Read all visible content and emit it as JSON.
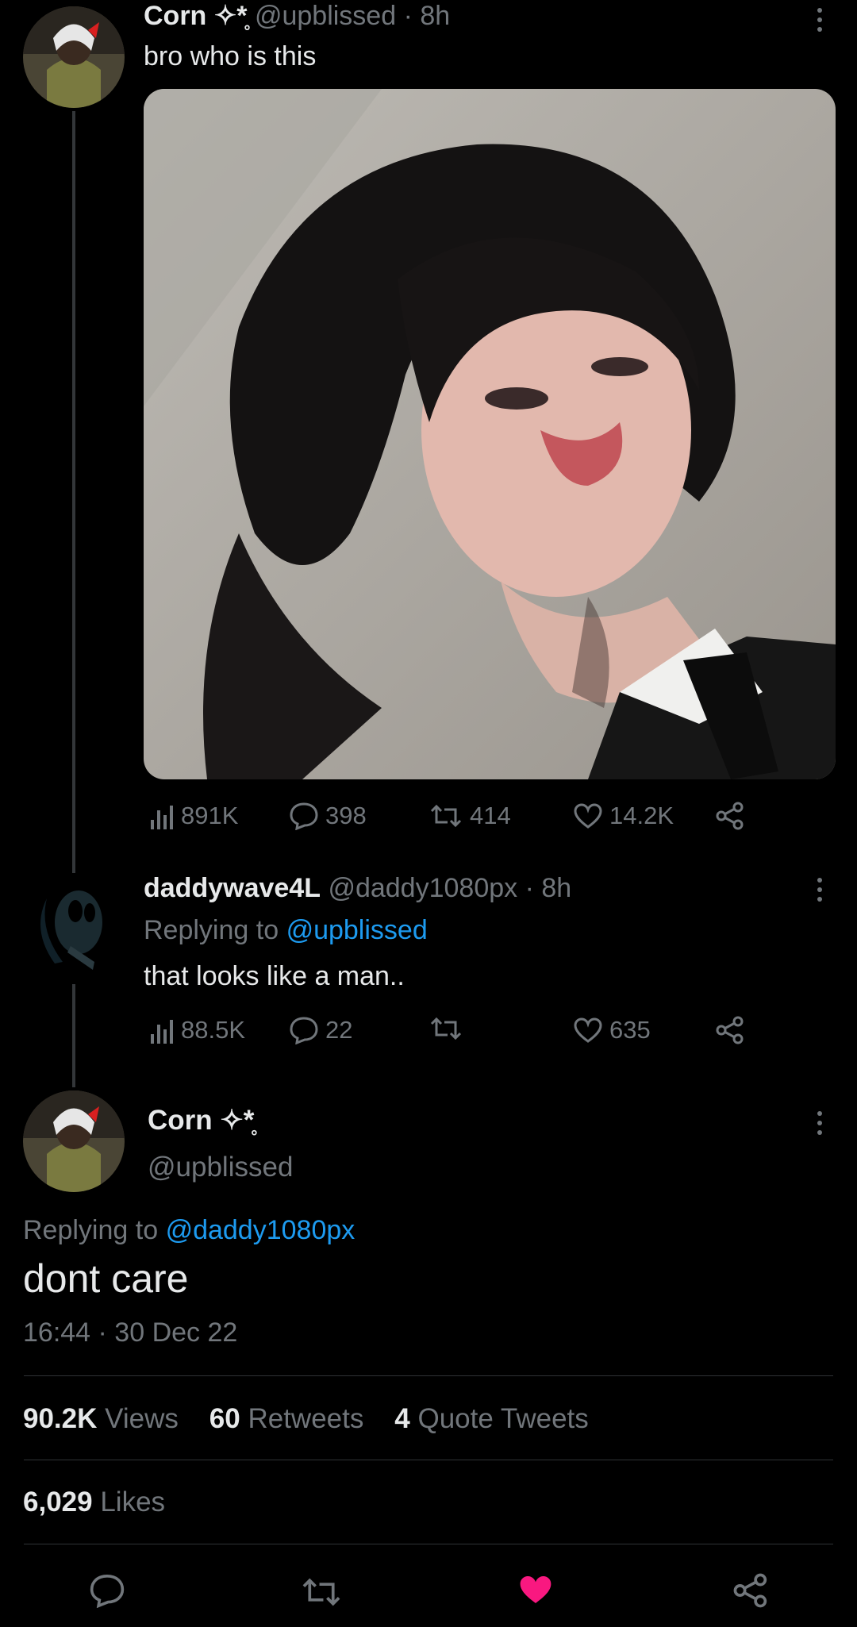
{
  "tweet1": {
    "name": "Corn ✧*̥",
    "handle": "@upblissed",
    "time": "· 8h",
    "text": "bro who is this",
    "views": "891K",
    "replies": "398",
    "retweets": "414",
    "likes": "14.2K"
  },
  "tweet2": {
    "name": "daddywave4L",
    "handle": "@daddy1080px",
    "time": "· 8h",
    "replying_prefix": "Replying to",
    "replying_to": "@upblissed",
    "text": "that looks like a man..",
    "views": "88.5K",
    "replies": "22",
    "retweets": "",
    "likes": "635"
  },
  "main": {
    "name": "Corn ✧*̥",
    "handle": "@upblissed",
    "replying_prefix": "Replying to",
    "replying_to": "@daddy1080px",
    "text": "dont care",
    "timestamp": "16:44 · 30 Dec 22",
    "views_count": "90.2K",
    "views_label": "Views",
    "retweets_count": "60",
    "retweets_label": "Retweets",
    "quotes_count": "4",
    "quotes_label": "Quote Tweets",
    "likes_count": "6,029",
    "likes_label": "Likes"
  },
  "colors": {
    "accent": "#1d9bf0",
    "like": "#f91880",
    "muted": "#71767b"
  },
  "icons": [
    "views-icon",
    "reply-icon",
    "retweet-icon",
    "like-icon",
    "share-icon",
    "more-icon"
  ]
}
